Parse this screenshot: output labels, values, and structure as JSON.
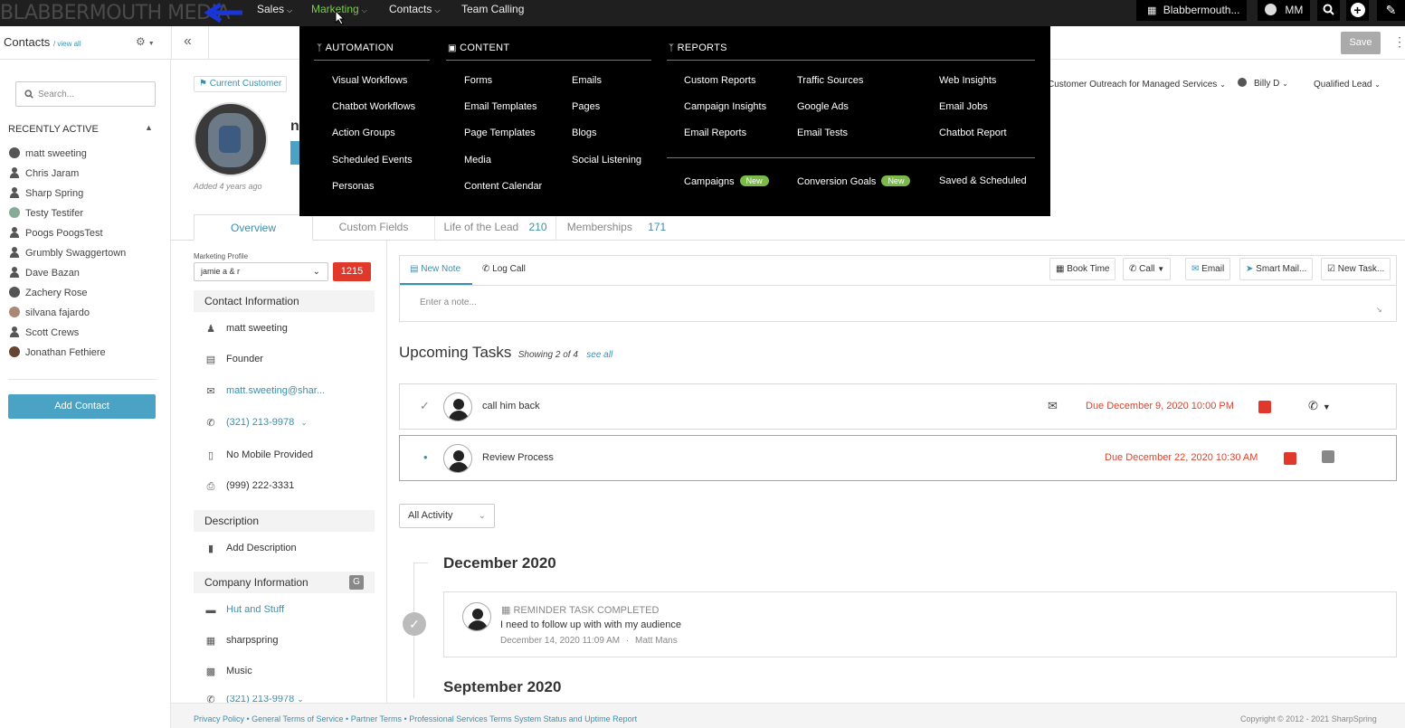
{
  "topbar": {
    "logo": "BLABBERMOUTH MEDIA",
    "nav": [
      {
        "label": "Sales"
      },
      {
        "label": "Marketing"
      },
      {
        "label": "Contacts"
      },
      {
        "label": "Team Calling"
      }
    ],
    "company": "Blabbermouth...",
    "user_initials": "MM"
  },
  "subbar": {
    "contacts_title": "Contacts",
    "view_all": "/ view all",
    "save_label": "Save"
  },
  "sidebar": {
    "search_placeholder": "Search...",
    "recently_active_title": "RECENTLY ACTIVE",
    "recent": [
      {
        "name": "matt sweeting",
        "icon": "photo"
      },
      {
        "name": "Chris Jaram",
        "icon": "user"
      },
      {
        "name": "Sharp Spring",
        "icon": "user"
      },
      {
        "name": "Testy Testifer",
        "icon": "photo"
      },
      {
        "name": "Poogs PoogsTest",
        "icon": "user"
      },
      {
        "name": "Grumbly Swaggertown",
        "icon": "user"
      },
      {
        "name": "Dave Bazan",
        "icon": "user"
      },
      {
        "name": "Zachery Rose",
        "icon": "photo"
      },
      {
        "name": "silvana fajardo",
        "icon": "photo"
      },
      {
        "name": "Scott Crews",
        "icon": "user"
      },
      {
        "name": "Jonathan Fethiere",
        "icon": "photo"
      }
    ],
    "add_contact": "Add Contact"
  },
  "mega_menu": {
    "automation": {
      "title": "AUTOMATION",
      "items": [
        "Visual Workflows",
        "Chatbot Workflows",
        "Action Groups",
        "Scheduled Events",
        "Personas"
      ]
    },
    "content": {
      "title": "CONTENT",
      "col1": [
        "Forms",
        "Email Templates",
        "Page Templates",
        "Media",
        "Content Calendar"
      ],
      "col2": [
        "Emails",
        "Pages",
        "Blogs",
        "Social Listening"
      ]
    },
    "reports": {
      "title": "REPORTS",
      "col1": [
        "Custom Reports",
        "Campaign Insights",
        "Email Reports"
      ],
      "col2": [
        "Traffic Sources",
        "Google Ads",
        "Email Tests"
      ],
      "col3": [
        "Web Insights",
        "Email Jobs",
        "Chatbot Report"
      ],
      "bottom": [
        {
          "label": "Campaigns",
          "badge": "New"
        },
        {
          "label": "Conversion Goals",
          "badge": "New"
        },
        {
          "label": "Saved & Scheduled"
        }
      ]
    }
  },
  "contact": {
    "tag": "Current Customer",
    "added": "Added 4 years ago",
    "campaign": "Customer Outreach for Managed Services",
    "owner": "Billy D",
    "lead_status": "Qualified Lead"
  },
  "tabs": [
    {
      "label": "Overview"
    },
    {
      "label": "Custom Fields"
    },
    {
      "label": "Life of the Lead",
      "count": "210"
    },
    {
      "label": "Memberships",
      "count": "171"
    }
  ],
  "profile": {
    "label": "Marketing Profile",
    "value": "jamie a & r",
    "score": "1215"
  },
  "contact_info": {
    "title": "Contact Information",
    "name": "matt sweeting",
    "title_value": "Founder",
    "email": "matt.sweeting@shar...",
    "phone": "(321) 213-9978",
    "mobile": "No Mobile Provided",
    "fax": "(999) 222-3331"
  },
  "description": {
    "title": "Description",
    "add": "Add Description"
  },
  "company_info": {
    "title": "Company Information",
    "badge": "G",
    "name": "Hut and Stuff",
    "website": "sharpspring",
    "industry": "Music",
    "phone": "(321) 213-9978"
  },
  "note": {
    "tab_new": "New Note",
    "tab_log": "Log Call",
    "placeholder": "Enter a note...",
    "actions": [
      "Book Time",
      "Call",
      "Email",
      "Smart Mail...",
      "New Task..."
    ]
  },
  "tasks": {
    "title": "Upcoming Tasks",
    "showing": "Showing 2 of 4",
    "see_all": "see all",
    "items": [
      {
        "name": "call him back",
        "due": "Due December 9, 2020 10:00 PM"
      },
      {
        "name": "Review Process",
        "due": "Due December 22, 2020 10:30 AM"
      }
    ]
  },
  "activity": {
    "filter": "All Activity",
    "month1": "December 2020",
    "entry": {
      "type": "REMINDER TASK COMPLETED",
      "text": "I need to follow up with with my audience",
      "date": "December 14, 2020 11:09 AM",
      "sep": "·",
      "user": "Matt Mans"
    },
    "month2": "September 2020"
  },
  "footer": {
    "links": "Privacy Policy • General Terms of Service • Partner Terms • Professional Services Terms System Status and Uptime Report",
    "copyright": "Copyright © 2012 - 2021 SharpSpring"
  },
  "colors": {
    "accent_green": "#7ccb4a",
    "link_blue": "#3b8fae",
    "due_red": "#d9442f",
    "button_teal": "#4aa3c4"
  }
}
